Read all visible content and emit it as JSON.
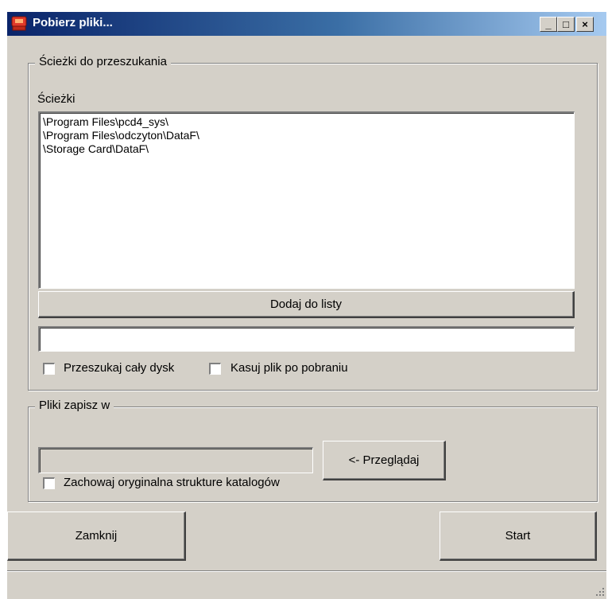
{
  "window": {
    "title": "Pobierz pliki...",
    "controls": {
      "minimize": "_",
      "maximize": "□",
      "close": "×"
    }
  },
  "search_group": {
    "legend": "Ścieżki do przeszukania",
    "paths_label": "Ścieżki",
    "paths": [
      "\\Program Files\\pcd4_sys\\",
      "\\Program Files\\odczyton\\DataF\\",
      "\\Storage Card\\DataF\\"
    ],
    "add_button": "Dodaj do listy",
    "path_input_value": "",
    "search_whole_disk_label": "Przeszukaj cały dysk",
    "search_whole_disk_checked": false,
    "delete_after_download_label": "Kasuj plik po pobraniu",
    "delete_after_download_checked": false
  },
  "save_group": {
    "legend": "Pliki zapisz w",
    "folder_value": "",
    "browse_button": "<- Przeglądaj",
    "keep_structure_label": "Zachowaj oryginalna strukture katalogów",
    "keep_structure_checked": false
  },
  "buttons": {
    "close": "Zamknij",
    "start": "Start"
  },
  "colors": {
    "face": "#d4d0c8",
    "title_start": "#0a246a",
    "title_end": "#a6caf0"
  }
}
